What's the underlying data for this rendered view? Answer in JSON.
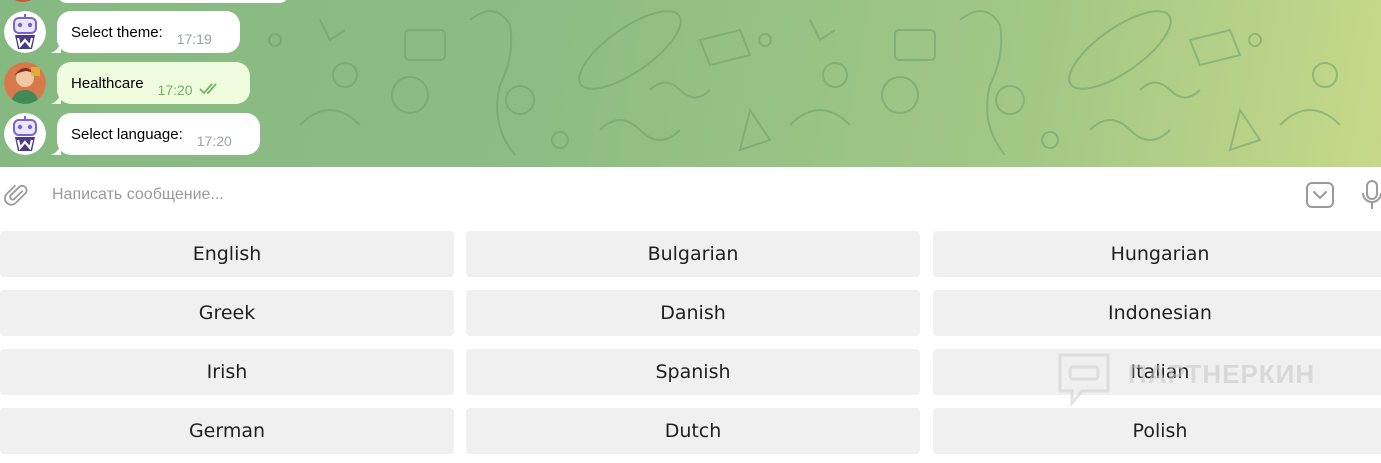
{
  "chat": {
    "messages": [
      {
        "sender": "bot",
        "text": "Select theme:",
        "time": "17:19"
      },
      {
        "sender": "user",
        "text": "Healthcare",
        "time": "17:20",
        "status": "read"
      },
      {
        "sender": "bot",
        "text": "Select language:",
        "time": "17:20"
      }
    ]
  },
  "composer": {
    "placeholder": "Написать сообщение...",
    "icons": [
      "paperclip-icon",
      "keyboard-toggle-icon",
      "microphone-icon"
    ]
  },
  "keyboard": {
    "rows": [
      [
        "English",
        "Bulgarian",
        "Hungarian"
      ],
      [
        "Greek",
        "Danish",
        "Indonesian"
      ],
      [
        "Irish",
        "Spanish",
        "Italian"
      ],
      [
        "German",
        "Dutch",
        "Polish"
      ]
    ]
  },
  "watermark": {
    "text": "ПАРТНЕРКИН"
  },
  "colors": {
    "incoming_bubble": "#ffffff",
    "outgoing_bubble": "#effdde",
    "button_bg": "#f0f0f0",
    "chat_bg": "#8dbd84"
  }
}
